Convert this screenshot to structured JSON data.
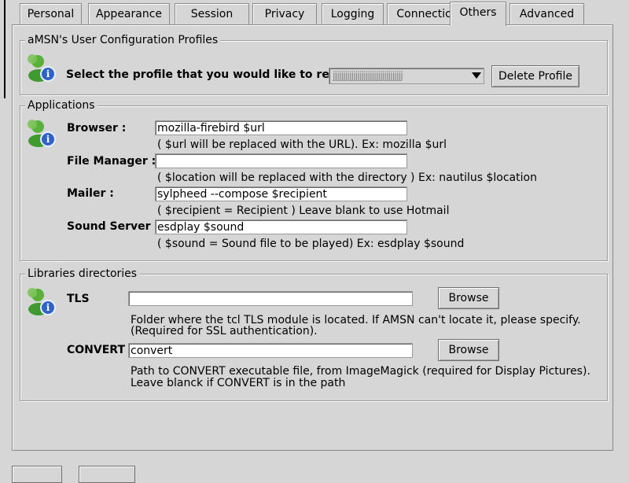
{
  "tabs": [
    "Personal",
    "Appearance",
    "Session",
    "Privacy",
    "Logging",
    "Connection",
    "Others",
    "Advanced"
  ],
  "active_tab": "Others",
  "profiles": {
    "legend": "aMSN's User Configuration Profiles",
    "prompt": "Select the profile that you would like to remove",
    "selected_value": "jjjjjjjjjjjjjjjjjjjjjjjjjjjjjjjjjj",
    "delete_label": "Delete Profile"
  },
  "applications": {
    "legend": "Applications",
    "browser_label": "Browser :",
    "browser_value": "mozilla-firebird $url",
    "browser_hint": "( $url will be replaced with the URL). Ex: mozilla $url",
    "file_manager_label": "File Manager :",
    "file_manager_value": "",
    "file_manager_hint": "( $location will be replaced with the directory ) Ex: nautilus $location",
    "mailer_label": "Mailer :",
    "mailer_value": "sylpheed --compose $recipient",
    "mailer_hint": "( $recipient = Recipient ) Leave blank to use Hotmail",
    "sound_label": "Sound Server :",
    "sound_value": "esdplay $sound",
    "sound_hint": "( $sound = Sound file to be played) Ex: esdplay $sound"
  },
  "libraries": {
    "legend": "Libraries directories",
    "tls_label": "TLS",
    "tls_value": "",
    "tls_hint_1": "Folder where the tcl TLS module is located. If AMSN can't locate it, please specify.",
    "tls_hint_2": "(Required for SSL authentication).",
    "convert_label": "CONVERT",
    "convert_value": "convert",
    "convert_hint_1": "Path to CONVERT executable file, from ImageMagick (required for Display Pictures).",
    "convert_hint_2": " Leave blanck if CONVERT is in the path",
    "browse_label": "Browse"
  }
}
